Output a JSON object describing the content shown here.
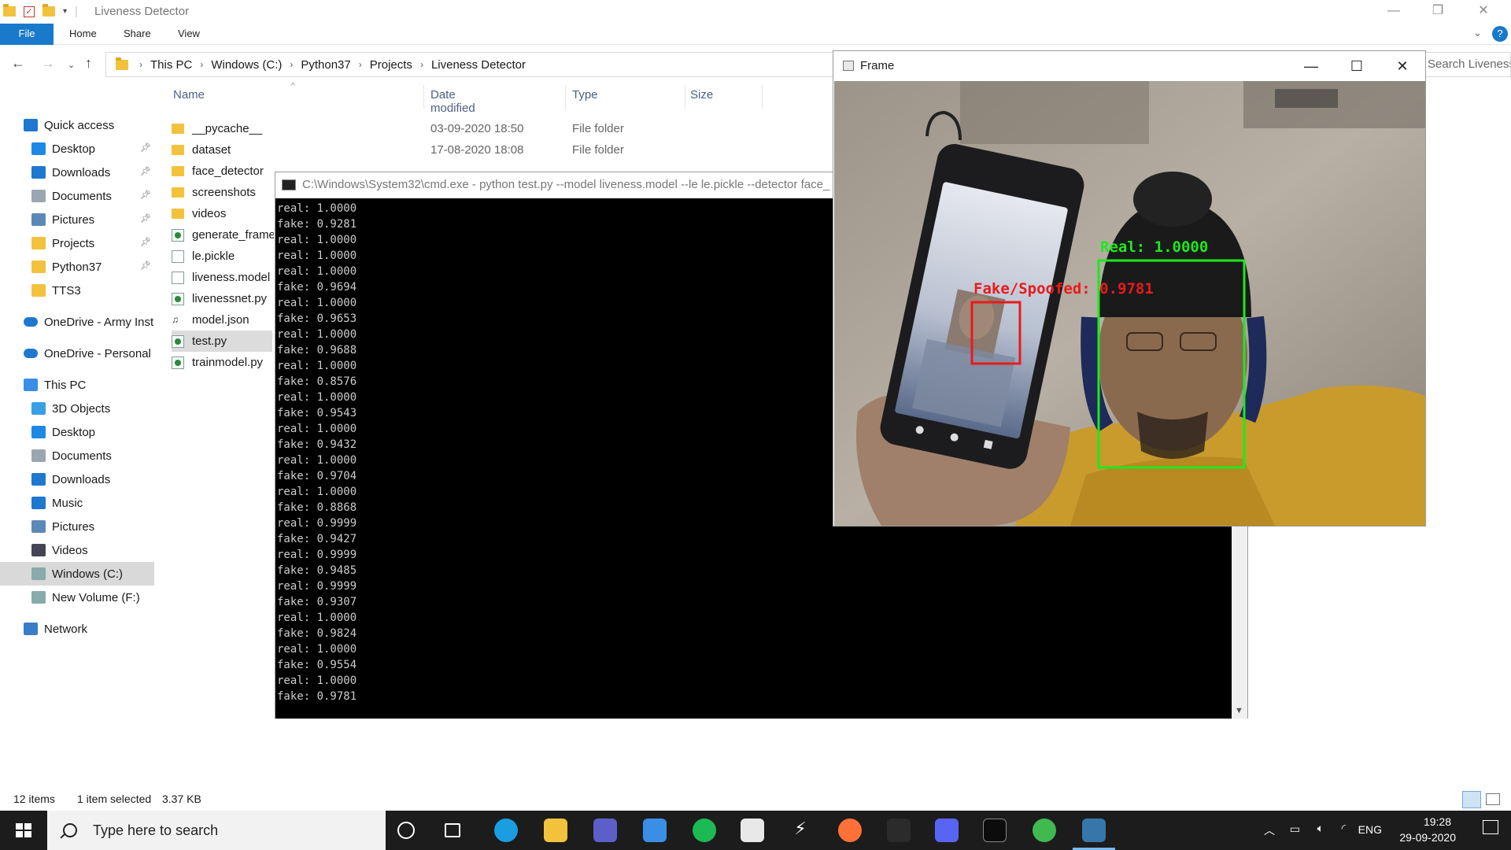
{
  "explorer": {
    "title": "Liveness Detector",
    "ribbon_tabs": [
      "File",
      "Home",
      "Share",
      "View"
    ],
    "breadcrumb": [
      "This PC",
      "Windows (C:)",
      "Python37",
      "Projects",
      "Liveness Detector"
    ],
    "search_placeholder": "Search Liveness De...",
    "columns": {
      "name": "Name",
      "date": "Date modified",
      "type": "Type",
      "size": "Size"
    },
    "nav": [
      {
        "label": "Quick access",
        "icon": "star-icon",
        "pinned": false
      },
      {
        "label": "Desktop",
        "icon": "desktop-icon",
        "pinned": true
      },
      {
        "label": "Downloads",
        "icon": "download-icon",
        "pinned": true
      },
      {
        "label": "Documents",
        "icon": "documents-icon",
        "pinned": true
      },
      {
        "label": "Pictures",
        "icon": "pictures-icon",
        "pinned": true
      },
      {
        "label": "Projects",
        "icon": "folder-icon",
        "pinned": true
      },
      {
        "label": "Python37",
        "icon": "folder-icon",
        "pinned": true
      },
      {
        "label": "TTS3",
        "icon": "folder-icon",
        "pinned": false
      },
      {
        "label": "OneDrive - Army Insti",
        "icon": "cloud-icon",
        "pinned": false
      },
      {
        "label": "OneDrive - Personal",
        "icon": "cloud-icon",
        "pinned": false
      },
      {
        "label": "This PC",
        "icon": "computer-icon",
        "pinned": false
      },
      {
        "label": "3D Objects",
        "icon": "cube-icon",
        "pinned": false
      },
      {
        "label": "Desktop",
        "icon": "desktop-icon",
        "pinned": false
      },
      {
        "label": "Documents",
        "icon": "documents-icon",
        "pinned": false
      },
      {
        "label": "Downloads",
        "icon": "download-icon",
        "pinned": false
      },
      {
        "label": "Music",
        "icon": "music-icon",
        "pinned": false
      },
      {
        "label": "Pictures",
        "icon": "pictures-icon",
        "pinned": false
      },
      {
        "label": "Videos",
        "icon": "videos-icon",
        "pinned": false
      },
      {
        "label": "Windows (C:)",
        "icon": "drive-icon",
        "pinned": false
      },
      {
        "label": "New Volume (F:)",
        "icon": "drive-icon",
        "pinned": false
      },
      {
        "label": "Network",
        "icon": "network-icon",
        "pinned": false
      }
    ],
    "files": [
      {
        "name": "__pycache__",
        "date": "03-09-2020 18:50",
        "type": "File folder",
        "kind": "folder"
      },
      {
        "name": "dataset",
        "date": "17-08-2020 18:08",
        "type": "File folder",
        "kind": "folder"
      },
      {
        "name": "face_detector",
        "date": "",
        "type": "",
        "kind": "folder"
      },
      {
        "name": "screenshots",
        "date": "",
        "type": "",
        "kind": "folder"
      },
      {
        "name": "videos",
        "date": "",
        "type": "",
        "kind": "folder"
      },
      {
        "name": "generate_frames",
        "date": "",
        "type": "",
        "kind": "py"
      },
      {
        "name": "le.pickle",
        "date": "",
        "type": "",
        "kind": "doc"
      },
      {
        "name": "liveness.model",
        "date": "",
        "type": "",
        "kind": "doc"
      },
      {
        "name": "livenessnet.py",
        "date": "",
        "type": "",
        "kind": "py"
      },
      {
        "name": "model.json",
        "date": "",
        "type": "",
        "kind": "json"
      },
      {
        "name": "test.py",
        "date": "",
        "type": "",
        "kind": "py"
      },
      {
        "name": "trainmodel.py",
        "date": "",
        "type": "",
        "kind": "py"
      }
    ],
    "status": {
      "items": "12 items",
      "selected": "1 item selected",
      "size": "3.37 KB"
    }
  },
  "cmd": {
    "title": "C:\\Windows\\System32\\cmd.exe - python  test.py --model liveness.model --le le.pickle --detector face_",
    "lines": [
      "real: 1.0000",
      "fake: 0.9281",
      "real: 1.0000",
      "real: 1.0000",
      "real: 1.0000",
      "fake: 0.9694",
      "real: 1.0000",
      "fake: 0.9653",
      "real: 1.0000",
      "fake: 0.9688",
      "real: 1.0000",
      "fake: 0.8576",
      "real: 1.0000",
      "fake: 0.9543",
      "real: 1.0000",
      "fake: 0.9432",
      "real: 1.0000",
      "fake: 0.9704",
      "real: 1.0000",
      "fake: 0.8868",
      "real: 0.9999",
      "fake: 0.9427",
      "real: 0.9999",
      "fake: 0.9485",
      "real: 0.9999",
      "fake: 0.9307",
      "real: 1.0000",
      "fake: 0.9824",
      "real: 1.0000",
      "fake: 0.9554",
      "real: 1.0000",
      "fake: 0.9781"
    ]
  },
  "frame": {
    "title": "Frame",
    "real_label": "Real: 1.0000",
    "fake_label": "Fake/Spoofed: 0.9781",
    "real_color": "#1ee81e",
    "fake_color": "#e81b1b"
  },
  "taskbar": {
    "search_placeholder": "Type here to search",
    "apps": [
      "cortana-icon",
      "task-view-icon",
      "edge-icon",
      "file-explorer-icon",
      "teams-icon",
      "mail-icon",
      "spotify-icon",
      "store-icon",
      "sublime-icon",
      "firefox-icon",
      "mysql-icon",
      "discord-icon",
      "terminal-icon",
      "atom-icon",
      "python-icon"
    ],
    "language": "ENG",
    "time": "19:28",
    "date": "29-09-2020"
  }
}
